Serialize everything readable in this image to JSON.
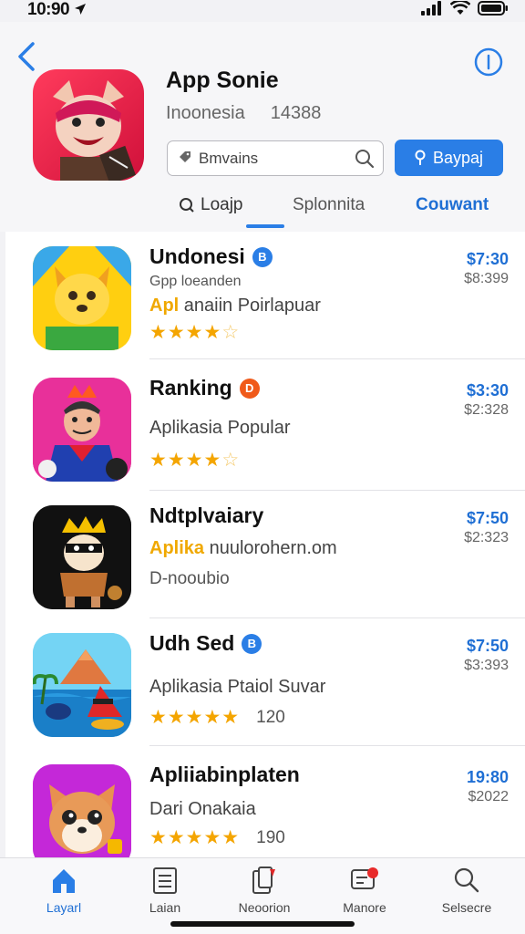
{
  "status": {
    "time": "10:90",
    "icons": [
      "location-arrow-icon",
      "signal-icon",
      "wifi-icon",
      "battery-icon"
    ]
  },
  "header": {
    "title": "App Sonie",
    "region": "Inoonesia",
    "count": "14388",
    "search": {
      "value": "Bmvains",
      "button_label": "Baypaj"
    },
    "tabs": [
      {
        "label": "Loajp"
      },
      {
        "label": "Splonnita"
      },
      {
        "label": "Couwant"
      }
    ]
  },
  "apps": [
    {
      "title": "Undonesi",
      "badge": "B",
      "line2": "Gpp loeanden",
      "line3_hl": "Apl",
      "line3": " anaiin Poirlapuar",
      "rating": "4.5",
      "price": "$7:30",
      "price_sub": "$8:399"
    },
    {
      "title": "Ranking",
      "badge": "D",
      "line3": "Aplikasia Popular",
      "rating": "4.5",
      "price": "$3:30",
      "price_sub": "$2:328"
    },
    {
      "title": "Ndtplvaiary",
      "line3_hl": "Aplika",
      "line3": " nuulorohern.om",
      "link": "D-nooubio",
      "price": "$7:50",
      "price_sub": "$2:323"
    },
    {
      "title": "Udh Sed",
      "badge": "B",
      "line3": "Aplikasia Ptaiol Suvar",
      "rating": "5",
      "rating_count": "120",
      "price": "$7:50",
      "price_sub": "$3:393"
    },
    {
      "title": "Apliiabinplaten",
      "line3": "Dari Onakaia",
      "rating": "5",
      "rating_count": "190",
      "price": "19:80",
      "price_sub": "$2022"
    }
  ],
  "tabbar": [
    {
      "label": "Layarl",
      "icon": "home-icon",
      "active": true
    },
    {
      "label": "Laian",
      "icon": "list-icon"
    },
    {
      "label": "Neoorion",
      "icon": "notification-icon"
    },
    {
      "label": "Manore",
      "icon": "message-icon"
    },
    {
      "label": "Selsecre",
      "icon": "search-icon"
    }
  ],
  "colors": {
    "accent": "#2a7ee6",
    "star": "#f4a500",
    "highlight": "#f0a800"
  }
}
